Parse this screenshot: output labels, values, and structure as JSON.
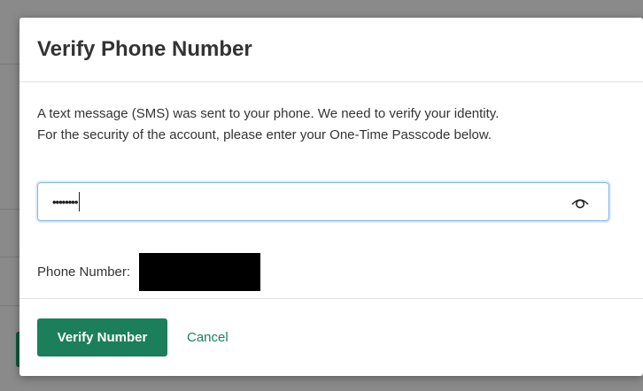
{
  "modal": {
    "title": "Verify Phone Number",
    "instructions_line1": "A text message (SMS) was sent to your phone. We need to verify your identity.",
    "instructions_line2": "For the security of the account, please enter your One-Time Passcode below.",
    "otp_input": {
      "value": "••••••••",
      "type": "password"
    },
    "show_password_icon": "eye-icon",
    "phone_label": "Phone Number:",
    "phone_value_redacted": true,
    "verify_button_label": "Verify Number",
    "cancel_link_label": "Cancel"
  },
  "colors": {
    "accent": "#1b7f5b",
    "focus_border": "#7fb4e6",
    "overlay": "#8a8a8a"
  }
}
